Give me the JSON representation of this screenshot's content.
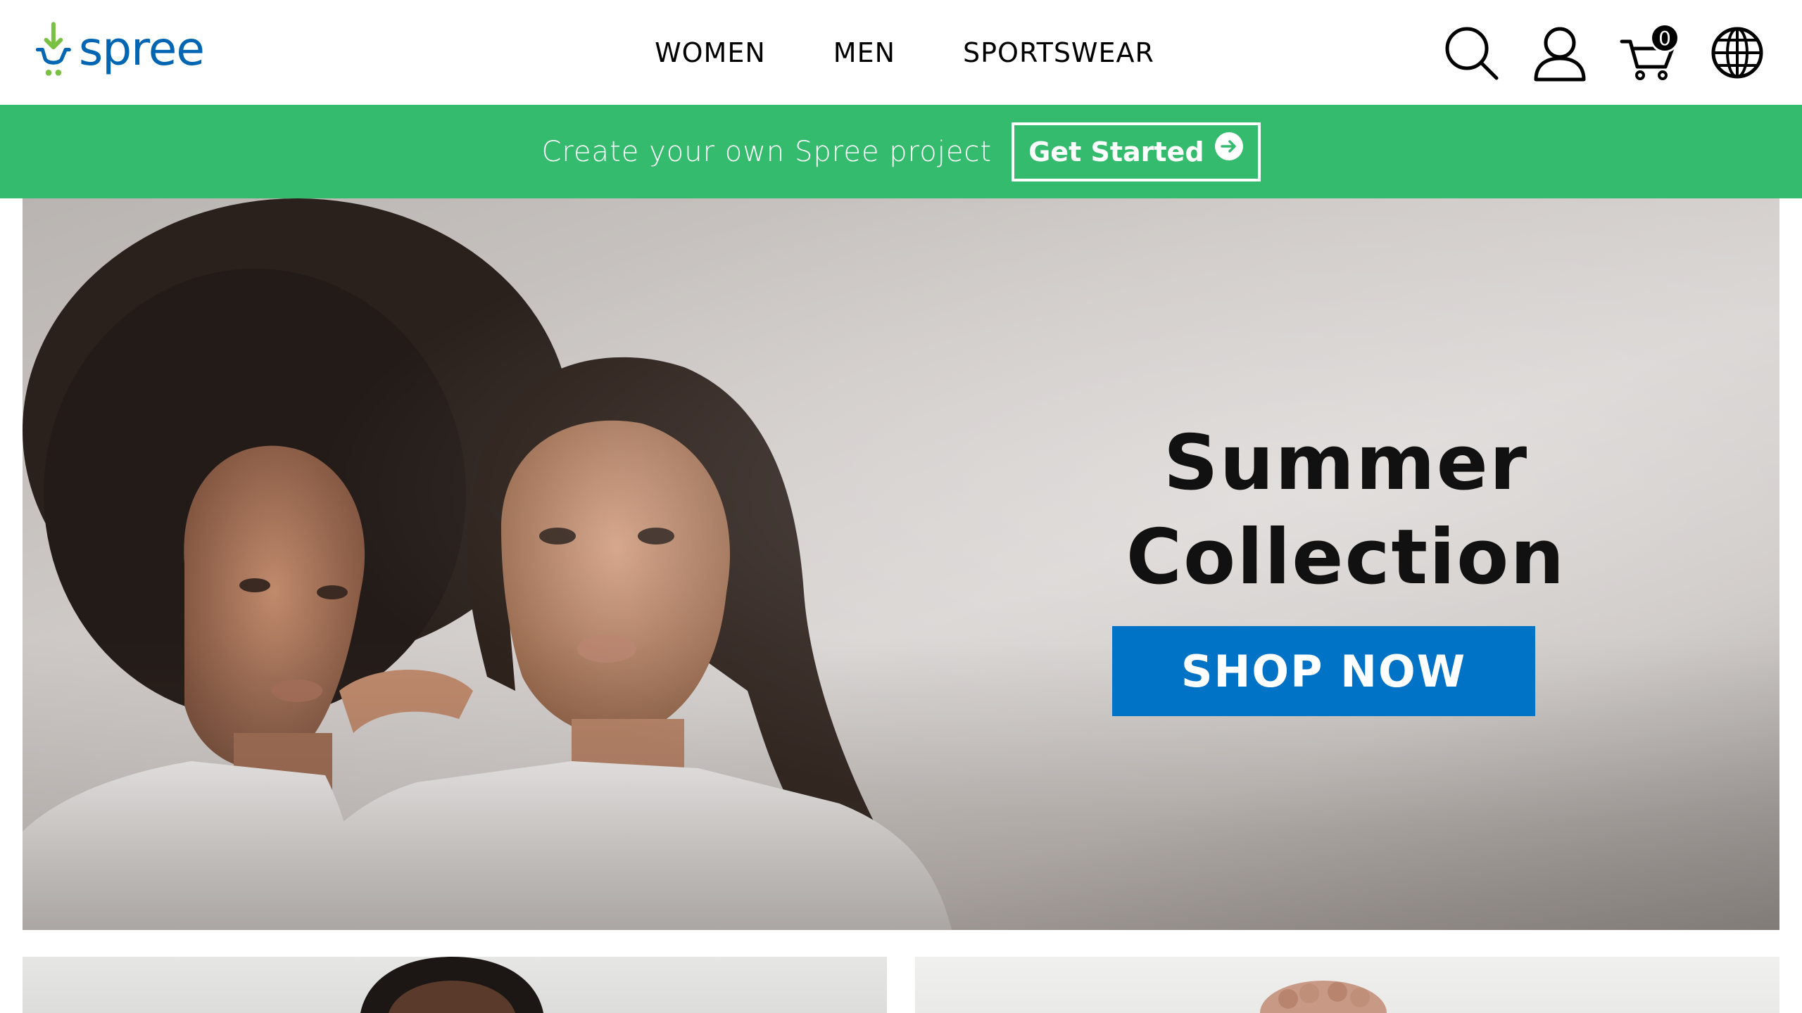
{
  "brand": {
    "name": "spree",
    "logo_icon": "spree-logo-icon",
    "logo_color": "#0066b3",
    "logo_accent": "#7ac143"
  },
  "nav": {
    "items": [
      {
        "label": "WOMEN"
      },
      {
        "label": "MEN"
      },
      {
        "label": "SPORTSWEAR"
      }
    ]
  },
  "header_icons": {
    "search": "search-icon",
    "account": "user-icon",
    "cart": "cart-icon",
    "cart_count": "0",
    "locale": "globe-icon"
  },
  "promo": {
    "text": "Create your own Spree project",
    "button_label": "Get Started",
    "button_icon": "arrow-right-circle-icon",
    "background": "#35bb6d"
  },
  "hero": {
    "title_line1": "Summer",
    "title_line2": "Collection",
    "cta_label": "SHOP NOW",
    "cta_color": "#0073c7",
    "image": "two-models-in-white-outfits"
  },
  "tiles": [
    {
      "image": "man-model"
    },
    {
      "image": "woman-model-curly-hair"
    }
  ]
}
